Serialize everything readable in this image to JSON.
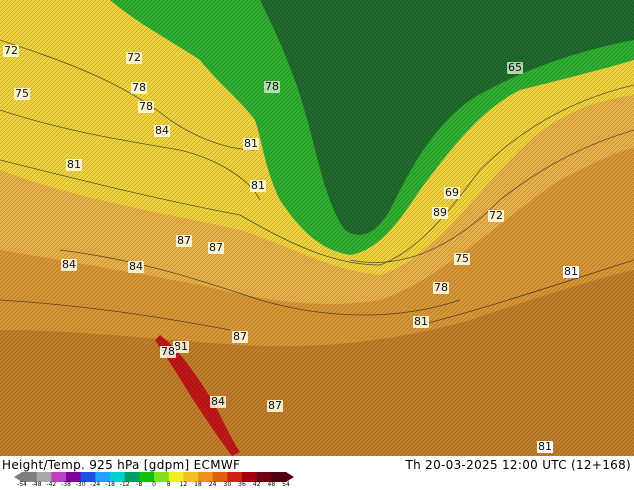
{
  "map": {
    "labels": [
      {
        "text": "72"
      },
      {
        "text": "72"
      },
      {
        "text": "75"
      },
      {
        "text": "78"
      },
      {
        "text": "78"
      },
      {
        "text": "78"
      },
      {
        "text": "84"
      },
      {
        "text": "81"
      },
      {
        "text": "81"
      },
      {
        "text": "81"
      },
      {
        "text": "84"
      },
      {
        "text": "84"
      },
      {
        "text": "87"
      },
      {
        "text": "87"
      },
      {
        "text": "87"
      },
      {
        "text": "81"
      },
      {
        "text": "87"
      },
      {
        "text": "84"
      },
      {
        "text": "87"
      },
      {
        "text": "78"
      },
      {
        "text": "81"
      },
      {
        "text": "75"
      },
      {
        "text": "78"
      },
      {
        "text": "81"
      },
      {
        "text": "81"
      },
      {
        "text": "65"
      },
      {
        "text": "69"
      },
      {
        "text": "72"
      },
      {
        "text": "75"
      },
      {
        "text": "78"
      },
      {
        "text": "81"
      },
      {
        "text": "81"
      }
    ],
    "colors": {
      "ocean_dark": "#1f6a2c",
      "green": "#2fae2f",
      "yellow": "#f0d23c",
      "light_orange": "#e8b048",
      "orange": "#d99635",
      "dark_orange": "#c27d2a",
      "red": "#c01818"
    }
  },
  "footer": {
    "title": "Height/Temp. 925 hPa [gdpm] ECMWF",
    "valid": "Th 20-03-2025 12:00 UTC (12+168)",
    "colorbar_ticks": [
      "-54",
      "-48",
      "-42",
      "-38",
      "-30",
      "-24",
      "-18",
      "-12",
      "-8",
      "0",
      "8",
      "12",
      "18",
      "24",
      "30",
      "36",
      "42",
      "48",
      "54"
    ],
    "colorbar_colors": [
      "#7f7f7f",
      "#a8a8a8",
      "#c040c0",
      "#8000a0",
      "#2050e0",
      "#20a0ff",
      "#00d0d0",
      "#00a060",
      "#10c010",
      "#80e020",
      "#f0f020",
      "#f0c020",
      "#f09020",
      "#e06010",
      "#d02010",
      "#a00010",
      "#700010",
      "#500010"
    ]
  }
}
